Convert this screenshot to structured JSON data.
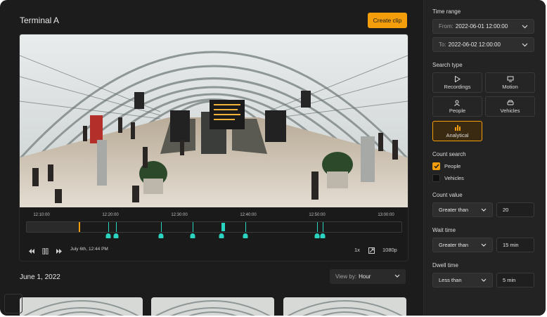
{
  "header": {
    "title": "Terminal A",
    "create_clip_label": "Create clip"
  },
  "player": {
    "timeline_ticks": [
      "12:10:00",
      "12:20:00",
      "12:30:00",
      "12:40:00",
      "12:50:00",
      "13:00:00"
    ],
    "date_label": "July 6th, 12:44 PM",
    "speed": "1x",
    "quality": "1080p",
    "event_markers_icon": "event-pin-icon"
  },
  "results": {
    "date_heading": "June 1, 2022",
    "view_by_label": "View by:",
    "view_by_value": "Hour"
  },
  "sidebar": {
    "time_range_label": "Time range",
    "from_prefix": "From:",
    "from_value": "2022-06-01 12:00:00",
    "to_prefix": "To:",
    "to_value": "2022-06-02 12:00:00",
    "search_type_label": "Search type",
    "search_types": [
      "Recordings",
      "Motion",
      "People",
      "Vehicles",
      "Analytical"
    ],
    "search_type_selected": "Analytical",
    "count_search_label": "Count search",
    "count_people_label": "People",
    "count_people_checked": true,
    "count_vehicles_label": "Vehicles",
    "count_vehicles_checked": false,
    "count_value_label": "Count value",
    "count_value_operator": "Greater than",
    "count_value": "20",
    "wait_time_label": "Wait time",
    "wait_time_operator": "Greater than",
    "wait_time_value": "15 min",
    "dwell_time_label": "Dwell time",
    "dwell_time_operator": "Less than",
    "dwell_time_value": "5 min"
  },
  "colors": {
    "accent": "#f59e0b",
    "event_marker": "#2bd4c0",
    "background": "#1c1c1c"
  }
}
